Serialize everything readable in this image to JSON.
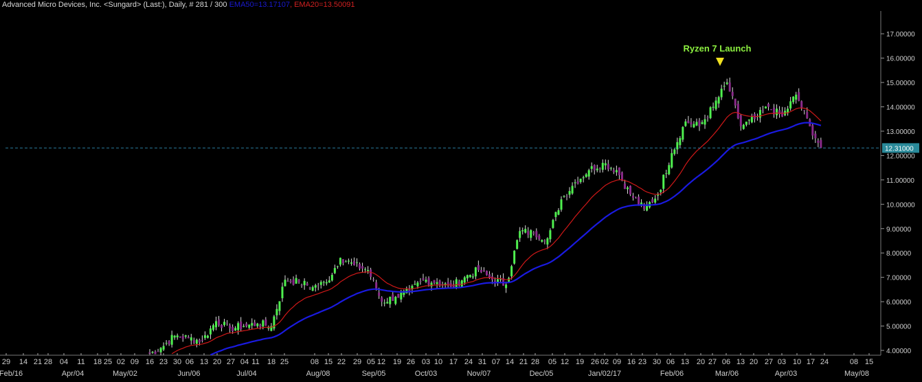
{
  "header": {
    "title": "Advanced Micro Devices, Inc.  <Sungard> (Last:), Daily, # 281 / 300",
    "ema50_label": "EMA50=13.17107",
    "ema20_label": ", EMA20=13.50091"
  },
  "chart_data": {
    "type": "candlestick",
    "title": "Advanced Micro Devices, Inc. Daily",
    "ylim": [
      4,
      17
    ],
    "y_ticks": [
      "4.00000",
      "5.00000",
      "6.00000",
      "7.00000",
      "8.00000",
      "9.00000",
      "10.00000",
      "11.00000",
      "12.00000",
      "13.00000",
      "14.00000",
      "15.00000",
      "16.00000",
      "17.00000"
    ],
    "x_day_ticks": [
      "29",
      "14",
      "21",
      "28",
      "04",
      "11",
      "18",
      "25",
      "02",
      "09",
      "16",
      "23",
      "30",
      "06",
      "13",
      "20",
      "27",
      "04",
      "11",
      "18",
      "25",
      "08",
      "15",
      "22",
      "29",
      "05",
      "12",
      "19",
      "26",
      "03",
      "10",
      "17",
      "24",
      "31",
      "07",
      "14",
      "21",
      "28",
      "05",
      "12",
      "19",
      "26",
      "02",
      "09",
      "16",
      "23",
      "30",
      "06",
      "13",
      "20",
      "27",
      "06",
      "13",
      "20",
      "27",
      "03",
      "10",
      "17",
      "24",
      "08",
      "15"
    ],
    "x_month_labels": [
      "Feb/16",
      "Apr/04",
      "May/02",
      "Jun/06",
      "Jul/04",
      "Aug/08",
      "Sep/05",
      "Oct/03",
      "Nov/07",
      "Dec/05",
      "Jan/02/17",
      "Feb/06",
      "Mar/06",
      "Apr/03",
      "May/08"
    ],
    "weekly_closes": [
      3.8,
      4.1,
      4.6,
      4.5,
      4.4,
      5.2,
      4.9,
      5.0,
      5.1,
      5.0,
      6.9,
      6.8,
      6.6,
      6.8,
      7.8,
      7.5,
      7.3,
      6.0,
      6.2,
      6.4,
      6.9,
      6.8,
      6.6,
      7.0,
      7.3,
      6.9,
      6.7,
      8.9,
      8.8,
      8.6,
      10.2,
      10.9,
      11.4,
      11.7,
      11.4,
      10.4,
      9.8,
      10.4,
      12.1,
      13.4,
      13.2,
      14.0,
      15.0,
      13.2,
      13.5,
      14.0,
      13.6,
      14.5,
      13.2,
      12.31
    ],
    "series": [
      {
        "name": "EMA50",
        "last": 13.17107,
        "color": "#1a1ae0"
      },
      {
        "name": "EMA20",
        "last": 13.50091,
        "color": "#d01818"
      }
    ],
    "last_price": "12.31000",
    "annotation": "Ryzen 7 Launch",
    "colors": {
      "up": "#4ff04f",
      "down": "#8a2a8a",
      "annotation": "#8cf040",
      "marker": "#f0e020",
      "last_line": "#2a7a9a"
    }
  }
}
